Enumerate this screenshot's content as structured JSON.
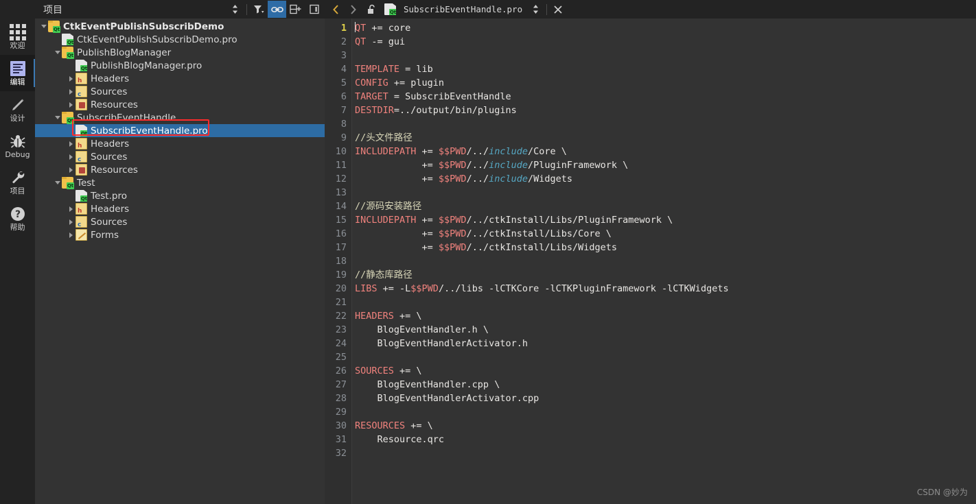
{
  "theme": {
    "bg_dark": "#232323",
    "panel_bg": "#333333",
    "editor_bg": "#333333",
    "gutter_bg": "#2f2f2f",
    "selection_blue": "#2d6ca4",
    "accent_blue": "#2e6ca6",
    "keyword_red": "#f0827d",
    "comment_yellow": "#d8d6b8",
    "text_main": "#e8e6e3",
    "italic_cyan": "#56a8c4",
    "highlight_red_box": "#ff2b2b",
    "current_line_number": "#e0d24a"
  },
  "modebar": {
    "items": [
      {
        "id": "welcome",
        "label": "欢迎",
        "icon": "grid-icon",
        "active": false
      },
      {
        "id": "edit",
        "label": "编辑",
        "icon": "document-icon",
        "active": true
      },
      {
        "id": "design",
        "label": "设计",
        "icon": "pencil-icon",
        "active": false
      },
      {
        "id": "debug",
        "label": "Debug",
        "icon": "bug-icon",
        "active": false
      },
      {
        "id": "projects",
        "label": "项目",
        "icon": "wrench-icon",
        "active": false
      },
      {
        "id": "help",
        "label": "帮助",
        "icon": "question-icon",
        "active": false
      }
    ]
  },
  "project_panel": {
    "title": "项目",
    "toolbar": [
      {
        "id": "sort",
        "icon": "updown-arrows-icon",
        "active": false
      },
      {
        "id": "filter",
        "icon": "filter-icon",
        "active": false
      },
      {
        "id": "synchronize",
        "icon": "link-icon",
        "active": true
      },
      {
        "id": "add-split",
        "icon": "split-add-icon",
        "active": false
      },
      {
        "id": "close-pane",
        "icon": "close-pane-icon",
        "active": false
      }
    ],
    "tree": [
      {
        "depth": 0,
        "arrow": "down",
        "icon": "qt-project-folder-icon",
        "label": "CtkEventPublishSubscribDemo",
        "bold": true,
        "selected": false
      },
      {
        "depth": 1,
        "arrow": "none",
        "icon": "qt-pro-file-icon",
        "label": "CtkEventPublishSubscribDemo.pro",
        "bold": false,
        "selected": false
      },
      {
        "depth": 1,
        "arrow": "down",
        "icon": "qt-project-folder-icon",
        "label": "PublishBlogManager",
        "bold": false,
        "selected": false
      },
      {
        "depth": 2,
        "arrow": "none",
        "icon": "qt-pro-file-icon",
        "label": "PublishBlogManager.pro",
        "bold": false,
        "selected": false
      },
      {
        "depth": 2,
        "arrow": "right",
        "icon": "headers-folder-icon",
        "label": "Headers",
        "bold": false,
        "selected": false
      },
      {
        "depth": 2,
        "arrow": "right",
        "icon": "sources-folder-icon",
        "label": "Sources",
        "bold": false,
        "selected": false
      },
      {
        "depth": 2,
        "arrow": "right",
        "icon": "resources-folder-icon",
        "label": "Resources",
        "bold": false,
        "selected": false
      },
      {
        "depth": 1,
        "arrow": "down",
        "icon": "qt-project-folder-icon",
        "label": "SubscribEventHandle",
        "bold": false,
        "selected": false
      },
      {
        "depth": 2,
        "arrow": "none",
        "icon": "qt-pro-file-icon",
        "label": "SubscribEventHandle.pro",
        "bold": false,
        "selected": true
      },
      {
        "depth": 2,
        "arrow": "right",
        "icon": "headers-folder-icon",
        "label": "Headers",
        "bold": false,
        "selected": false
      },
      {
        "depth": 2,
        "arrow": "right",
        "icon": "sources-folder-icon",
        "label": "Sources",
        "bold": false,
        "selected": false
      },
      {
        "depth": 2,
        "arrow": "right",
        "icon": "resources-folder-icon",
        "label": "Resources",
        "bold": false,
        "selected": false
      },
      {
        "depth": 1,
        "arrow": "down",
        "icon": "qt-project-folder-icon",
        "label": "Test",
        "bold": false,
        "selected": false
      },
      {
        "depth": 2,
        "arrow": "none",
        "icon": "qt-pro-file-icon",
        "label": "Test.pro",
        "bold": false,
        "selected": false
      },
      {
        "depth": 2,
        "arrow": "right",
        "icon": "headers-folder-icon",
        "label": "Headers",
        "bold": false,
        "selected": false
      },
      {
        "depth": 2,
        "arrow": "right",
        "icon": "sources-folder-icon",
        "label": "Sources",
        "bold": false,
        "selected": false
      },
      {
        "depth": 2,
        "arrow": "right",
        "icon": "forms-folder-icon",
        "label": "Forms",
        "bold": false,
        "selected": false
      }
    ]
  },
  "editor": {
    "tabbar": {
      "back_icon": "chevron-left-icon",
      "forward_icon": "chevron-right-icon",
      "lock_icon": "unlocked-padlock-icon",
      "file_icon": "qt-pro-file-icon",
      "filename": "SubscribEventHandle.pro",
      "selector_icon": "updown-arrows-icon",
      "close_icon": "close-x-icon"
    },
    "current_line": 1,
    "total_lines": 32,
    "lines": [
      {
        "n": 1,
        "tokens": [
          {
            "t": "kw",
            "v": "QT"
          },
          {
            "t": "op",
            "v": " += core"
          }
        ]
      },
      {
        "n": 2,
        "tokens": [
          {
            "t": "kw",
            "v": "QT"
          },
          {
            "t": "op",
            "v": " -= gui"
          }
        ]
      },
      {
        "n": 3,
        "tokens": []
      },
      {
        "n": 4,
        "tokens": [
          {
            "t": "kw",
            "v": "TEMPLATE"
          },
          {
            "t": "op",
            "v": " = lib"
          }
        ]
      },
      {
        "n": 5,
        "tokens": [
          {
            "t": "kw",
            "v": "CONFIG"
          },
          {
            "t": "op",
            "v": " += plugin"
          }
        ]
      },
      {
        "n": 6,
        "tokens": [
          {
            "t": "kw",
            "v": "TARGET"
          },
          {
            "t": "op",
            "v": " = SubscribEventHandle"
          }
        ]
      },
      {
        "n": 7,
        "tokens": [
          {
            "t": "kw",
            "v": "DESTDIR"
          },
          {
            "t": "op",
            "v": "=../output/bin/plugins"
          }
        ]
      },
      {
        "n": 8,
        "tokens": []
      },
      {
        "n": 9,
        "tokens": [
          {
            "t": "cmt",
            "v": "//头文件路径"
          }
        ]
      },
      {
        "n": 10,
        "tokens": [
          {
            "t": "kw",
            "v": "INCLUDEPATH"
          },
          {
            "t": "op",
            "v": " += "
          },
          {
            "t": "var",
            "v": "$$PWD"
          },
          {
            "t": "op",
            "v": "/../"
          },
          {
            "t": "itl",
            "v": "include"
          },
          {
            "t": "op",
            "v": "/Core \\"
          }
        ]
      },
      {
        "n": 11,
        "tokens": [
          {
            "t": "op",
            "v": "            += "
          },
          {
            "t": "var",
            "v": "$$PWD"
          },
          {
            "t": "op",
            "v": "/../"
          },
          {
            "t": "itl",
            "v": "include"
          },
          {
            "t": "op",
            "v": "/PluginFramework \\"
          }
        ]
      },
      {
        "n": 12,
        "tokens": [
          {
            "t": "op",
            "v": "            += "
          },
          {
            "t": "var",
            "v": "$$PWD"
          },
          {
            "t": "op",
            "v": "/../"
          },
          {
            "t": "itl",
            "v": "include"
          },
          {
            "t": "op",
            "v": "/Widgets"
          }
        ]
      },
      {
        "n": 13,
        "tokens": []
      },
      {
        "n": 14,
        "tokens": [
          {
            "t": "cmt",
            "v": "//源码安装路径"
          }
        ]
      },
      {
        "n": 15,
        "tokens": [
          {
            "t": "kw",
            "v": "INCLUDEPATH"
          },
          {
            "t": "op",
            "v": " += "
          },
          {
            "t": "var",
            "v": "$$PWD"
          },
          {
            "t": "op",
            "v": "/../ctkInstall/Libs/PluginFramework \\"
          }
        ]
      },
      {
        "n": 16,
        "tokens": [
          {
            "t": "op",
            "v": "            += "
          },
          {
            "t": "var",
            "v": "$$PWD"
          },
          {
            "t": "op",
            "v": "/../ctkInstall/Libs/Core \\"
          }
        ]
      },
      {
        "n": 17,
        "tokens": [
          {
            "t": "op",
            "v": "            += "
          },
          {
            "t": "var",
            "v": "$$PWD"
          },
          {
            "t": "op",
            "v": "/../ctkInstall/Libs/Widgets"
          }
        ]
      },
      {
        "n": 18,
        "tokens": []
      },
      {
        "n": 19,
        "tokens": [
          {
            "t": "cmt",
            "v": "//静态库路径"
          }
        ]
      },
      {
        "n": 20,
        "tokens": [
          {
            "t": "kw",
            "v": "LIBS"
          },
          {
            "t": "op",
            "v": " += -L"
          },
          {
            "t": "var",
            "v": "$$PWD"
          },
          {
            "t": "op",
            "v": "/../libs -lCTKCore -lCTKPluginFramework -lCTKWidgets"
          }
        ]
      },
      {
        "n": 21,
        "tokens": []
      },
      {
        "n": 22,
        "tokens": [
          {
            "t": "kw",
            "v": "HEADERS"
          },
          {
            "t": "op",
            "v": " += \\"
          }
        ]
      },
      {
        "n": 23,
        "tokens": [
          {
            "t": "op",
            "v": "    BlogEventHandler.h \\"
          }
        ]
      },
      {
        "n": 24,
        "tokens": [
          {
            "t": "op",
            "v": "    BlogEventHandlerActivator.h"
          }
        ]
      },
      {
        "n": 25,
        "tokens": []
      },
      {
        "n": 26,
        "tokens": [
          {
            "t": "kw",
            "v": "SOURCES"
          },
          {
            "t": "op",
            "v": " += \\"
          }
        ]
      },
      {
        "n": 27,
        "tokens": [
          {
            "t": "op",
            "v": "    BlogEventHandler.cpp \\"
          }
        ]
      },
      {
        "n": 28,
        "tokens": [
          {
            "t": "op",
            "v": "    BlogEventHandlerActivator.cpp"
          }
        ]
      },
      {
        "n": 29,
        "tokens": []
      },
      {
        "n": 30,
        "tokens": [
          {
            "t": "kw",
            "v": "RESOURCES"
          },
          {
            "t": "op",
            "v": " += \\"
          }
        ]
      },
      {
        "n": 31,
        "tokens": [
          {
            "t": "op",
            "v": "    Resource.qrc"
          }
        ]
      },
      {
        "n": 32,
        "tokens": []
      }
    ]
  },
  "watermark": "CSDN @妙为"
}
